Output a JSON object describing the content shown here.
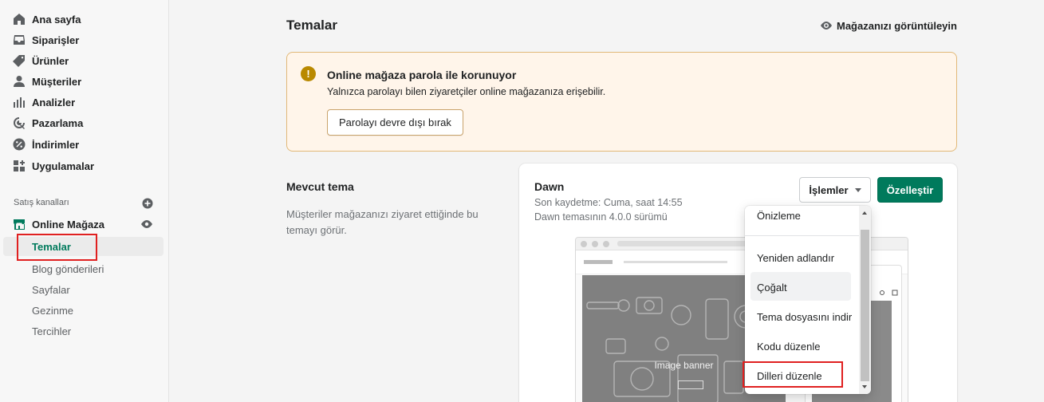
{
  "sidebar": {
    "items": [
      {
        "label": "Ana sayfa",
        "icon": "home-icon"
      },
      {
        "label": "Siparişler",
        "icon": "inbox-icon"
      },
      {
        "label": "Ürünler",
        "icon": "tag-icon"
      },
      {
        "label": "Müşteriler",
        "icon": "person-icon"
      },
      {
        "label": "Analizler",
        "icon": "bar-chart-icon"
      },
      {
        "label": "Pazarlama",
        "icon": "target-icon"
      },
      {
        "label": "İndirimler",
        "icon": "discount-icon"
      },
      {
        "label": "Uygulamalar",
        "icon": "apps-icon"
      }
    ],
    "channels_label": "Satış kanalları",
    "online_store": {
      "label": "Online Mağaza",
      "icon": "store-icon"
    },
    "sub_items": [
      "Temalar",
      "Blog gönderileri",
      "Sayfalar",
      "Gezinme",
      "Tercihler"
    ]
  },
  "header": {
    "title": "Temalar",
    "view_store": "Mağazanızı görüntüleyin"
  },
  "banner": {
    "icon": "!",
    "title": "Online mağaza parola ile korunuyor",
    "text": "Yalnızca parolayı bilen ziyaretçiler online mağazanıza erişebilir.",
    "button": "Parolayı devre dışı bırak",
    "accent": "#b98900"
  },
  "current_theme": {
    "section_title": "Mevcut tema",
    "section_desc": "Müşteriler mağazanızı ziyaret ettiğinde bu temayı görür.",
    "name": "Dawn",
    "saved": "Son kaydetme: Cuma, saat 14:55",
    "version": "Dawn temasının 4.0.0 sürümü",
    "actions_button": "İşlemler",
    "customize_button": "Özelleştir",
    "preview_label": "Image banner",
    "brand_color": "#007a5c"
  },
  "dropdown": {
    "items": [
      "Önizleme",
      "Yeniden adlandır",
      "Çoğalt",
      "Tema dosyasını indir",
      "Kodu düzenle",
      "Dilleri düzenle"
    ]
  }
}
